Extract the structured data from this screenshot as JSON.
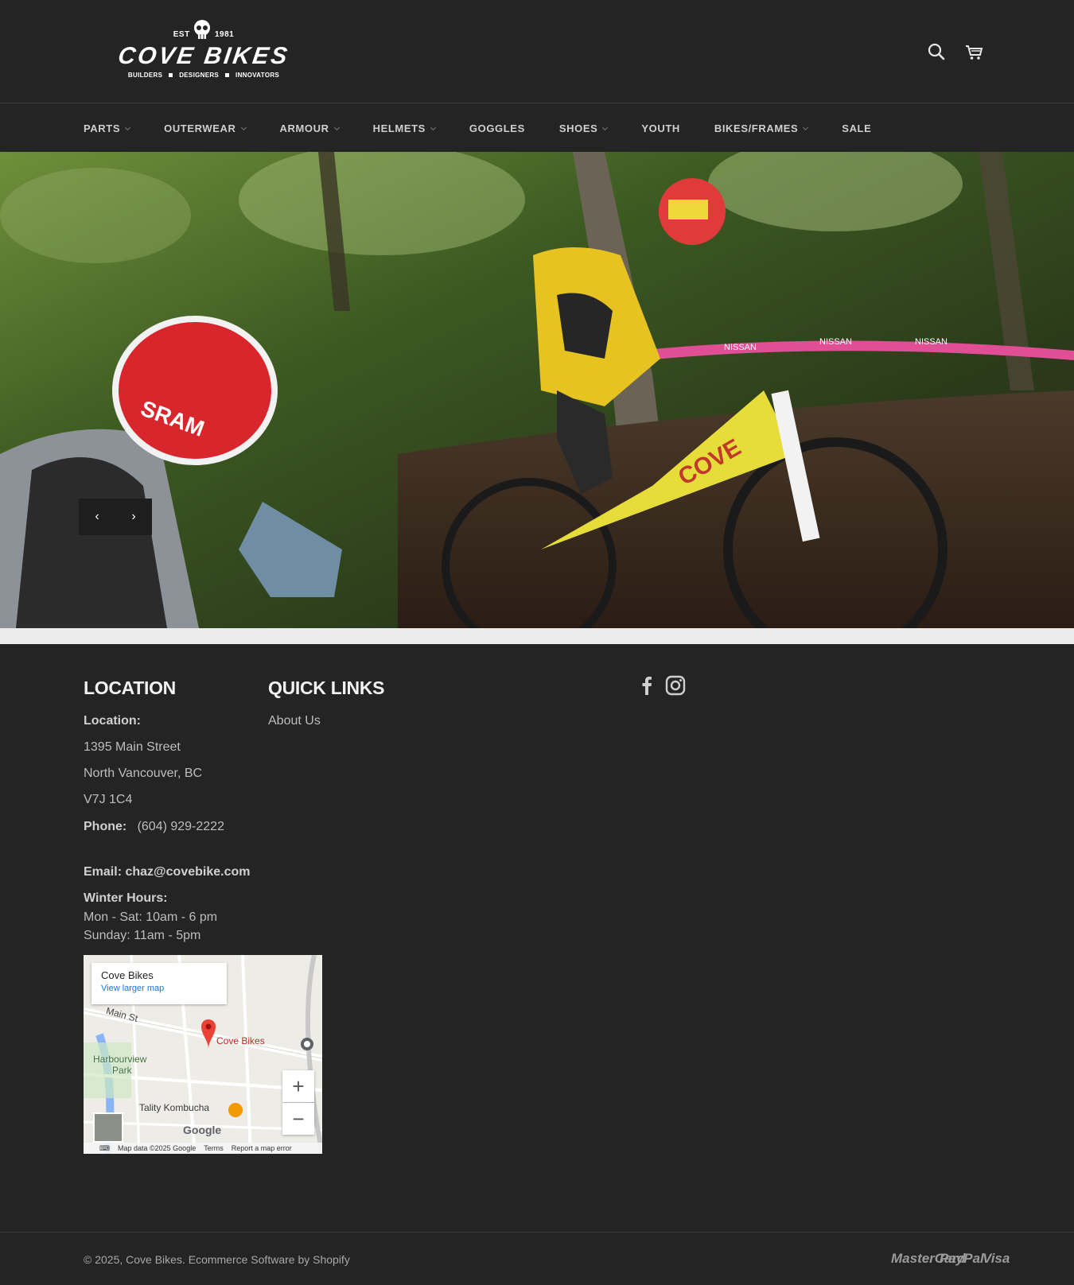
{
  "header": {
    "logo": {
      "est_label": "EST",
      "year": "1981",
      "brand": "COVE BIKES",
      "tagline": [
        "BUILDERS",
        "DESIGNERS",
        "INNOVATORS"
      ]
    },
    "icons": [
      "search-icon",
      "cart-icon"
    ]
  },
  "nav": {
    "items": [
      {
        "label": "PARTS",
        "dropdown": true
      },
      {
        "label": "OUTERWEAR",
        "dropdown": true
      },
      {
        "label": "ARMOUR",
        "dropdown": true
      },
      {
        "label": "HELMETS",
        "dropdown": true
      },
      {
        "label": "GOGGLES",
        "dropdown": false
      },
      {
        "label": "SHOES",
        "dropdown": true
      },
      {
        "label": "YOUTH",
        "dropdown": false
      },
      {
        "label": "BIKES/FRAMES",
        "dropdown": true
      },
      {
        "label": "SALE",
        "dropdown": false
      }
    ]
  },
  "hero": {
    "prev_label": "‹",
    "next_label": "›",
    "banner_texts": [
      "NISSAN",
      "NISSAN",
      "NISSAN"
    ],
    "helmet_text": "SRAM",
    "frame_text": "COVE"
  },
  "footer": {
    "location": {
      "title": "LOCATION",
      "label": "Location:",
      "street": "1395 Main Street",
      "city": "North Vancouver, BC",
      "postal": "V7J 1C4",
      "phone_label": "Phone:",
      "phone": "(604) 929-2222",
      "email_label": "Email:",
      "email": "chaz@covebike.com",
      "hours_label": "Winter Hours:",
      "hours_weekday": "Mon - Sat: 10am - 6 pm",
      "hours_sunday": "Sunday: 11am - 5pm"
    },
    "quick_links": {
      "title": "QUICK LINKS",
      "links": [
        "About Us"
      ]
    },
    "social": [
      "facebook-icon",
      "instagram-icon"
    ],
    "map": {
      "place_name": "Cove Bikes",
      "larger_map_link": "View larger map",
      "pin_label": "Cove Bikes",
      "street_label": "Main St",
      "park_label_1": "Harbourview",
      "park_label_2": "Park",
      "poi_label": "Tality Kombucha",
      "zoom_in": "+",
      "zoom_out": "−",
      "google_label": "Google",
      "attribution": "Map data ©2025 Google",
      "terms": "Terms",
      "report": "Report a map error"
    }
  },
  "bottom": {
    "copyright_prefix": "© 2025,",
    "brand_link": "Cove Bikes",
    "powered": ". Ecommerce Software by Shopify",
    "payments": [
      "MasterCard",
      "PayPal",
      "Visa"
    ]
  },
  "colors": {
    "background": "#242424",
    "footer_text": "#bdbdbd",
    "accent_link": "#1a73e8",
    "pin_red": "#ea4335"
  }
}
